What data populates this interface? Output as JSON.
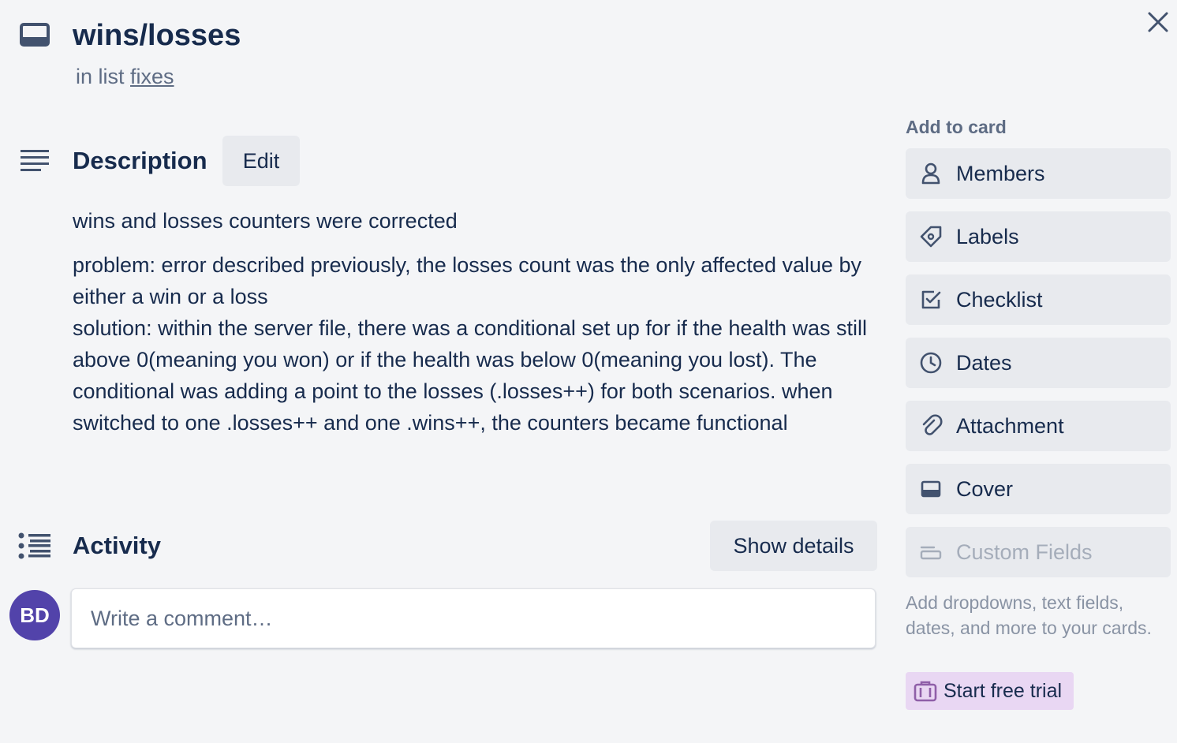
{
  "card": {
    "title": "wins/losses",
    "list_prefix": "in list",
    "list_name": "fixes"
  },
  "description": {
    "heading": "Description",
    "edit_label": "Edit",
    "paragraphs": [
      "wins and losses counters were corrected",
      "problem: error described previously, the losses count was the only affected value by either a win or a loss",
      "solution: within the server file, there was a conditional set up for if the health was still above 0(meaning you won) or if the health was below 0(meaning you lost). The conditional was adding a point to the losses (.losses++) for both scenarios. when switched to one .losses++ and one .wins++, the counters became functional"
    ]
  },
  "activity": {
    "heading": "Activity",
    "show_details_label": "Show details",
    "avatar_initials": "BD",
    "comment_placeholder": "Write a comment…"
  },
  "sidebar": {
    "heading": "Add to card",
    "items": [
      {
        "label": "Members",
        "icon": "person-icon"
      },
      {
        "label": "Labels",
        "icon": "tag-icon"
      },
      {
        "label": "Checklist",
        "icon": "checkbox-icon"
      },
      {
        "label": "Dates",
        "icon": "clock-icon"
      },
      {
        "label": "Attachment",
        "icon": "paperclip-icon"
      },
      {
        "label": "Cover",
        "icon": "cover-icon"
      },
      {
        "label": "Custom Fields",
        "icon": "custom-fields-icon",
        "disabled": true
      }
    ],
    "custom_fields_help": "Add dropdowns, text fields, dates, and more to your cards.",
    "trial_label": "Start free trial"
  },
  "colors": {
    "background": "#f4f5f7",
    "text": "#172b4d",
    "button_bg": "#e8eaee",
    "avatar_bg": "#5243aa",
    "trial_bg": "#e9d7f3",
    "trial_icon": "#8f5fa8"
  }
}
